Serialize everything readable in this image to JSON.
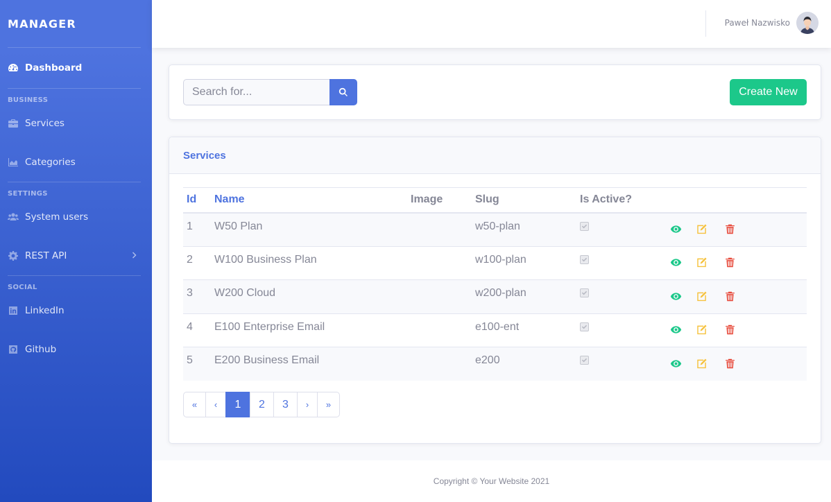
{
  "sidebar": {
    "brand": "MANAGER",
    "dashboard": "Dashboard",
    "heading_business": "BUSINESS",
    "services": "Services",
    "categories": "Categories",
    "heading_settings": "SETTINGS",
    "system_users": "System users",
    "rest_api": "REST API",
    "heading_social": "SOCIAL",
    "linkedin": "LinkedIn",
    "github": "Github"
  },
  "topbar": {
    "user_name": "Paweł Nazwisko"
  },
  "search": {
    "placeholder": "Search for...",
    "value": ""
  },
  "create_button": "Create New",
  "services_card": {
    "title": "Services",
    "columns": [
      "Id",
      "Name",
      "Image",
      "Slug",
      "Is Active?",
      ""
    ],
    "rows": [
      {
        "id": "1",
        "name": "W50 Plan",
        "image": "",
        "slug": "w50-plan",
        "active": true
      },
      {
        "id": "2",
        "name": "W100 Business Plan",
        "image": "",
        "slug": "w100-plan",
        "active": true
      },
      {
        "id": "3",
        "name": "W200 Cloud",
        "image": "",
        "slug": "w200-plan",
        "active": true
      },
      {
        "id": "4",
        "name": "E100 Enterprise Email",
        "image": "",
        "slug": "e100-ent",
        "active": true
      },
      {
        "id": "5",
        "name": "E200 Business Email",
        "image": "",
        "slug": "e200",
        "active": true
      }
    ]
  },
  "pagination": {
    "first": "«",
    "prev": "‹",
    "pages": [
      "1",
      "2",
      "3"
    ],
    "current": "1",
    "next": "›",
    "last": "»"
  },
  "footer": "Copyright © Your Website 2021",
  "colors": {
    "primary": "#4e73df",
    "success": "#1cc88a",
    "warning": "#f6c23e",
    "danger": "#e74a3b"
  },
  "icons": {
    "view": "eye-icon",
    "edit": "edit-icon",
    "delete": "trash-icon",
    "search": "search-icon"
  }
}
